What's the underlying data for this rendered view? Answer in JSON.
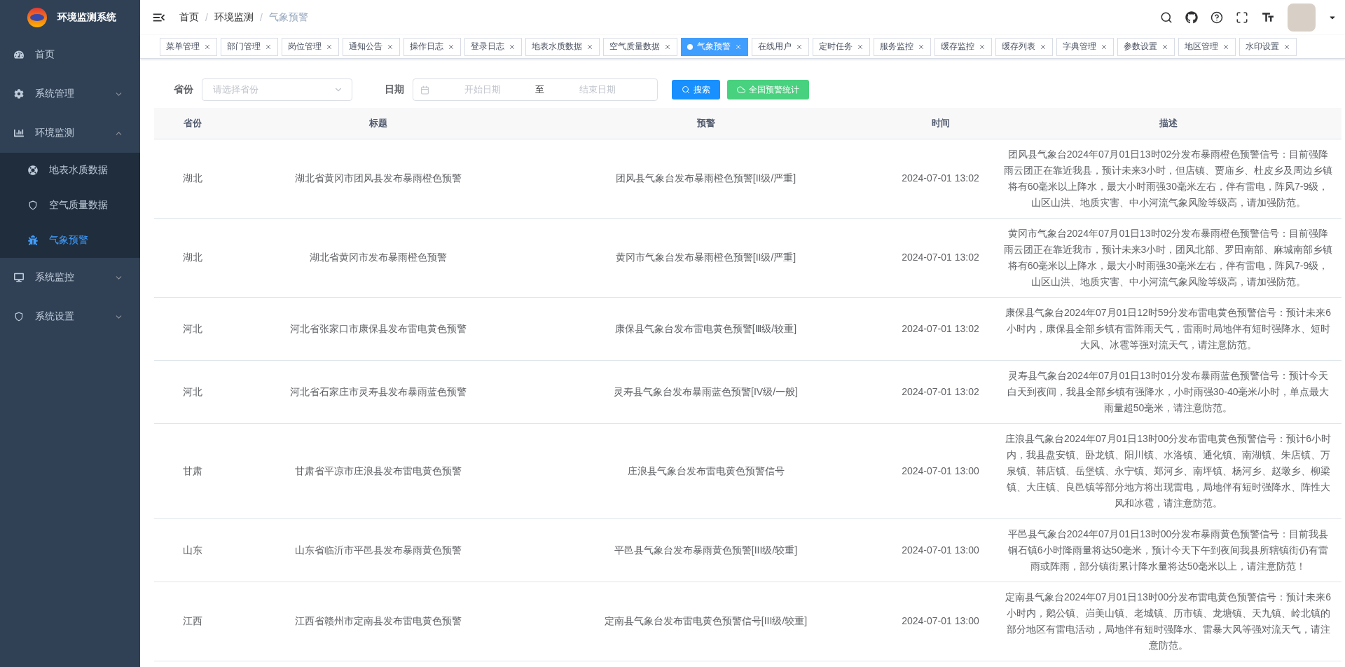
{
  "sidebar": {
    "title": "环境监测系统",
    "items": [
      {
        "label": "首页",
        "selected": false
      },
      {
        "label": "系统管理",
        "selected": false,
        "expanded": false
      },
      {
        "label": "环境监测",
        "selected": false,
        "expanded": true,
        "children": [
          {
            "label": "地表水质数据",
            "selected": false
          },
          {
            "label": "空气质量数据",
            "selected": false
          },
          {
            "label": "气象预警",
            "selected": true
          }
        ]
      },
      {
        "label": "系统监控",
        "selected": false,
        "expanded": false
      },
      {
        "label": "系统设置",
        "selected": false,
        "expanded": false
      }
    ]
  },
  "breadcrumb": [
    "首页",
    "环境监测",
    "气象预警"
  ],
  "breadcrumb_separator": "/",
  "tabs": [
    {
      "label": "菜单管理",
      "selected": false
    },
    {
      "label": "部门管理",
      "selected": false
    },
    {
      "label": "岗位管理",
      "selected": false
    },
    {
      "label": "通知公告",
      "selected": false
    },
    {
      "label": "操作日志",
      "selected": false
    },
    {
      "label": "登录日志",
      "selected": false
    },
    {
      "label": "地表水质数据",
      "selected": false
    },
    {
      "label": "空气质量数据",
      "selected": false
    },
    {
      "label": "气象预警",
      "selected": true
    },
    {
      "label": "在线用户",
      "selected": false
    },
    {
      "label": "定时任务",
      "selected": false
    },
    {
      "label": "服务监控",
      "selected": false
    },
    {
      "label": "缓存监控",
      "selected": false
    },
    {
      "label": "缓存列表",
      "selected": false
    },
    {
      "label": "字典管理",
      "selected": false
    },
    {
      "label": "参数设置",
      "selected": false
    },
    {
      "label": "地区管理",
      "selected": false
    },
    {
      "label": "水印设置",
      "selected": false
    }
  ],
  "filter": {
    "province_label": "省份",
    "province_placeholder": "请选择省份",
    "date_label": "日期",
    "start_placeholder": "开始日期",
    "separator": "至",
    "end_placeholder": "结束日期",
    "search_button": "搜索",
    "stats_button": "全国预警统计"
  },
  "table": {
    "columns": [
      "省份",
      "标题",
      "预警",
      "时间",
      "描述"
    ],
    "rows": [
      [
        "湖北",
        "湖北省黄冈市团风县发布暴雨橙色预警",
        "团风县气象台发布暴雨橙色预警[II级/严重]",
        "2024-07-01 13:02",
        "团风县气象台2024年07月01日13时02分发布暴雨橙色预警信号：目前强降雨云团正在靠近我县，预计未来3小时，但店镇、贾庙乡、杜皮乡及周边乡镇将有60毫米以上降水，最大小时雨强30毫米左右，伴有雷电，阵风7-9级，山区山洪、地质灾害、中小河流气象风险等级高，请加强防范。"
      ],
      [
        "湖北",
        "湖北省黄冈市发布暴雨橙色预警",
        "黄冈市气象台发布暴雨橙色预警[II级/严重]",
        "2024-07-01 13:02",
        "黄冈市气象台2024年07月01日13时02分发布暴雨橙色预警信号：目前强降雨云团正在靠近我市，预计未来3小时，团风北部、罗田南部、麻城南部乡镇将有60毫米以上降水，最大小时雨强30毫米左右，伴有雷电，阵风7-9级，山区山洪、地质灾害、中小河流气象风险等级高，请加强防范。"
      ],
      [
        "河北",
        "河北省张家口市康保县发布雷电黄色预警",
        "康保县气象台发布雷电黄色预警[Ⅲ级/较重]",
        "2024-07-01 13:02",
        "康保县气象台2024年07月01日12时59分发布雷电黄色预警信号：预计未来6小时内，康保县全部乡镇有雷阵雨天气，雷雨时局地伴有短时强降水、短时大风、冰雹等强对流天气，请注意防范。"
      ],
      [
        "河北",
        "河北省石家庄市灵寿县发布暴雨蓝色预警",
        "灵寿县气象台发布暴雨蓝色预警[IV级/一般]",
        "2024-07-01 13:02",
        "灵寿县气象台2024年07月01日13时01分发布暴雨蓝色预警信号：预计今天白天到夜间，我县全部乡镇有强降水，小时雨强30-40毫米/小时，单点最大雨量超50毫米，请注意防范。"
      ],
      [
        "甘肃",
        "甘肃省平凉市庄浪县发布雷电黄色预警",
        "庄浪县气象台发布雷电黄色预警信号",
        "2024-07-01 13:00",
        "庄浪县气象台2024年07月01日13时00分发布雷电黄色预警信号：预计6小时内，我县盘安镇、卧龙镇、阳川镇、水洛镇、通化镇、南湖镇、朱店镇、万泉镇、韩店镇、岳堡镇、永宁镇、郑河乡、南坪镇、杨河乡、赵墩乡、柳梁镇、大庄镇、良邑镇等部分地方将出现雷电，局地伴有短时强降水、阵性大风和冰雹，请注意防范。"
      ],
      [
        "山东",
        "山东省临沂市平邑县发布暴雨黄色预警",
        "平邑县气象台发布暴雨黄色预警[III级/较重]",
        "2024-07-01 13:00",
        "平邑县气象台2024年07月01日13时00分发布暴雨黄色预警信号：目前我县铜石镇6小时降雨量将达50毫米，预计今天下午到夜间我县所辖镇街仍有雷雨或阵雨，部分镇街累计降水量将达50毫米以上，请注意防范！"
      ],
      [
        "江西",
        "江西省赣州市定南县发布雷电黄色预警",
        "定南县气象台发布雷电黄色预警信号[III级/较重]",
        "2024-07-01 13:00",
        "定南县气象台2024年07月01日13时00分发布雷电黄色预警信号：预计未来6小时内，鹅公镇、岿美山镇、老城镇、历市镇、龙塘镇、天九镇、岭北镇的部分地区有雷电活动，局地伴有短时强降水、雷暴大风等强对流天气，请注意防范。"
      ]
    ]
  }
}
